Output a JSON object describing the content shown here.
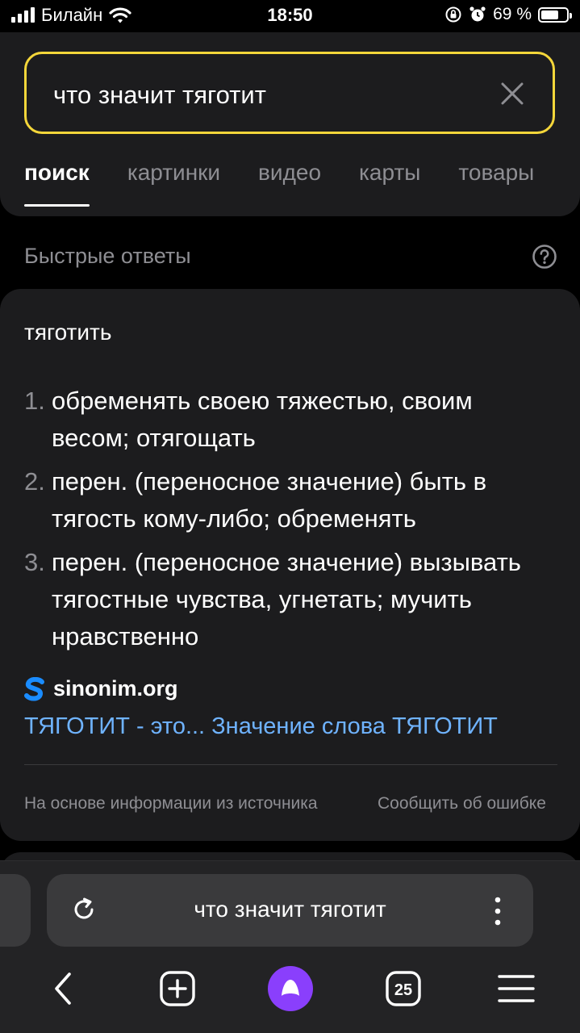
{
  "status_bar": {
    "carrier": "Билайн",
    "time": "18:50",
    "battery_percent": "69 %",
    "battery_level": 0.69,
    "icons": [
      "signal-icon",
      "wifi-icon",
      "rotation-lock-icon",
      "alarm-icon",
      "battery-icon"
    ]
  },
  "search": {
    "query": "что значит тяготит",
    "clear_icon": "close-icon"
  },
  "tabs": [
    {
      "label": "поиск",
      "active": true
    },
    {
      "label": "картинки",
      "active": false
    },
    {
      "label": "видео",
      "active": false
    },
    {
      "label": "карты",
      "active": false
    },
    {
      "label": "товары",
      "active": false
    }
  ],
  "quick_answers": {
    "heading": "Быстрые ответы",
    "help_icon": "question-circle-icon"
  },
  "card": {
    "term": "тяготить",
    "definitions": [
      {
        "num": "1.",
        "text": "обременять своею тяжестью, своим весом; отягощать"
      },
      {
        "num": "2.",
        "text": "перен. (переносное значение) быть в тягость кому-либо; обременять"
      },
      {
        "num": "3.",
        "text": "перен. (переносное значение) вызывать тягостные чувства, угнетать; мучить нравственно"
      }
    ],
    "source_name": "sinonim.org",
    "source_link": "ТЯГОТИТ - это... Значение слова ТЯГОТИТ",
    "footer_left": "На основе информации из источника",
    "footer_right": "Сообщить об ошибке"
  },
  "browser": {
    "omnibox_text": "что значит тяготит",
    "tabs_count": "25",
    "icons": [
      "reload-icon",
      "more-vertical-icon",
      "back-icon",
      "new-tab-icon",
      "alice-icon",
      "tabs-icon",
      "menu-icon"
    ]
  },
  "colors": {
    "accent_border": "#f4d63a",
    "link": "#6fb3ff",
    "muted": "#8e8e93",
    "card_bg": "#1c1c1e",
    "alice": "#8a3ffc"
  }
}
